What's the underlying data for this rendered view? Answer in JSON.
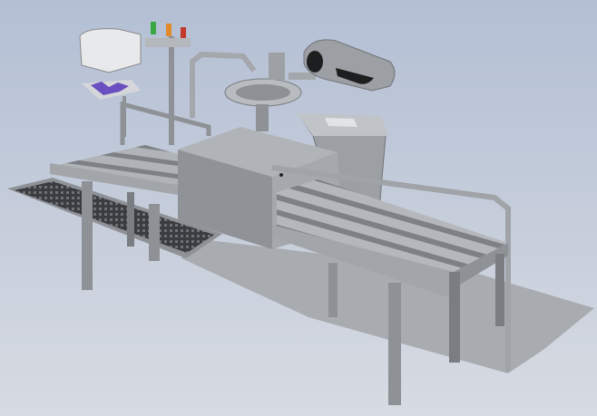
{
  "scene": {
    "subject": "hygiene-station-conveyor-cad-model",
    "colors": {
      "background_top": "#b3bfd4",
      "background_bottom": "#d7dbe2",
      "metal": "#9a9da2",
      "metal_light": "#b4b7bb",
      "metal_dark": "#6f7276",
      "floor": "#a8abaf",
      "mat": "#3a3c40",
      "glove": "#6a4fc0",
      "light_green": "#3aa845",
      "light_orange": "#e08a2a",
      "light_red": "#c23a2a"
    }
  }
}
